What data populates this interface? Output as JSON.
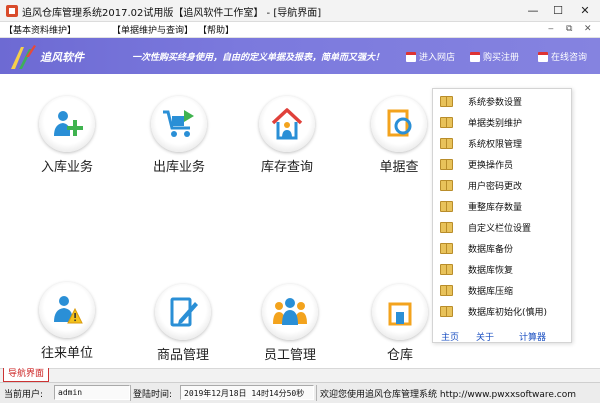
{
  "window": {
    "title": "追风仓库管理系统2017.02试用版【追风软件工作室】 - [导航界面]"
  },
  "menu": {
    "items": [
      "【基本资料维护】",
      "【单据维护与查询】",
      "【帮助】"
    ],
    "mdi_buttons": [
      "‒",
      "⧉",
      "✕"
    ]
  },
  "banner": {
    "logo_text": "追风软件",
    "slogan": "一次性购买终身使用，自由的定义单据及报表，简单而又强大！",
    "links": [
      "进入网店",
      "购买注册",
      "在线咨询"
    ],
    "accent_color": "#7775d9"
  },
  "functions": [
    {
      "label": "入库业务",
      "icon": "stock-in-icon"
    },
    {
      "label": "出库业务",
      "icon": "cart-out-icon"
    },
    {
      "label": "库存查询",
      "icon": "house-icon"
    },
    {
      "label": "单据查",
      "icon": "document-search-icon"
    },
    {
      "label": "往来单位",
      "icon": "contact-unit-icon"
    },
    {
      "label": "商品管理",
      "icon": "edit-document-icon"
    },
    {
      "label": "员工管理",
      "icon": "staff-icon"
    },
    {
      "label": "仓库",
      "icon": "warehouse-icon"
    }
  ],
  "popup": {
    "items": [
      "系统参数设置",
      "单据类别维护",
      "系统权限管理",
      "更换操作员",
      "用户密码更改",
      "重整库存数量",
      "自定义栏位设置",
      "数据库备份",
      "数据库恢复",
      "数据库压缩",
      "数据库初始化(慎用)"
    ],
    "footer": [
      "主页",
      "关于",
      "计算器"
    ]
  },
  "tabs": {
    "active": "导航界面"
  },
  "status": {
    "user_label": "当前用户:",
    "user_value": "admin",
    "time_label": "登陆时间:",
    "time_value": "2019年12月18日 14时14分50秒",
    "welcome": "欢迎您使用追风仓库管理系统 http://www.pwxxsoftware.com"
  }
}
